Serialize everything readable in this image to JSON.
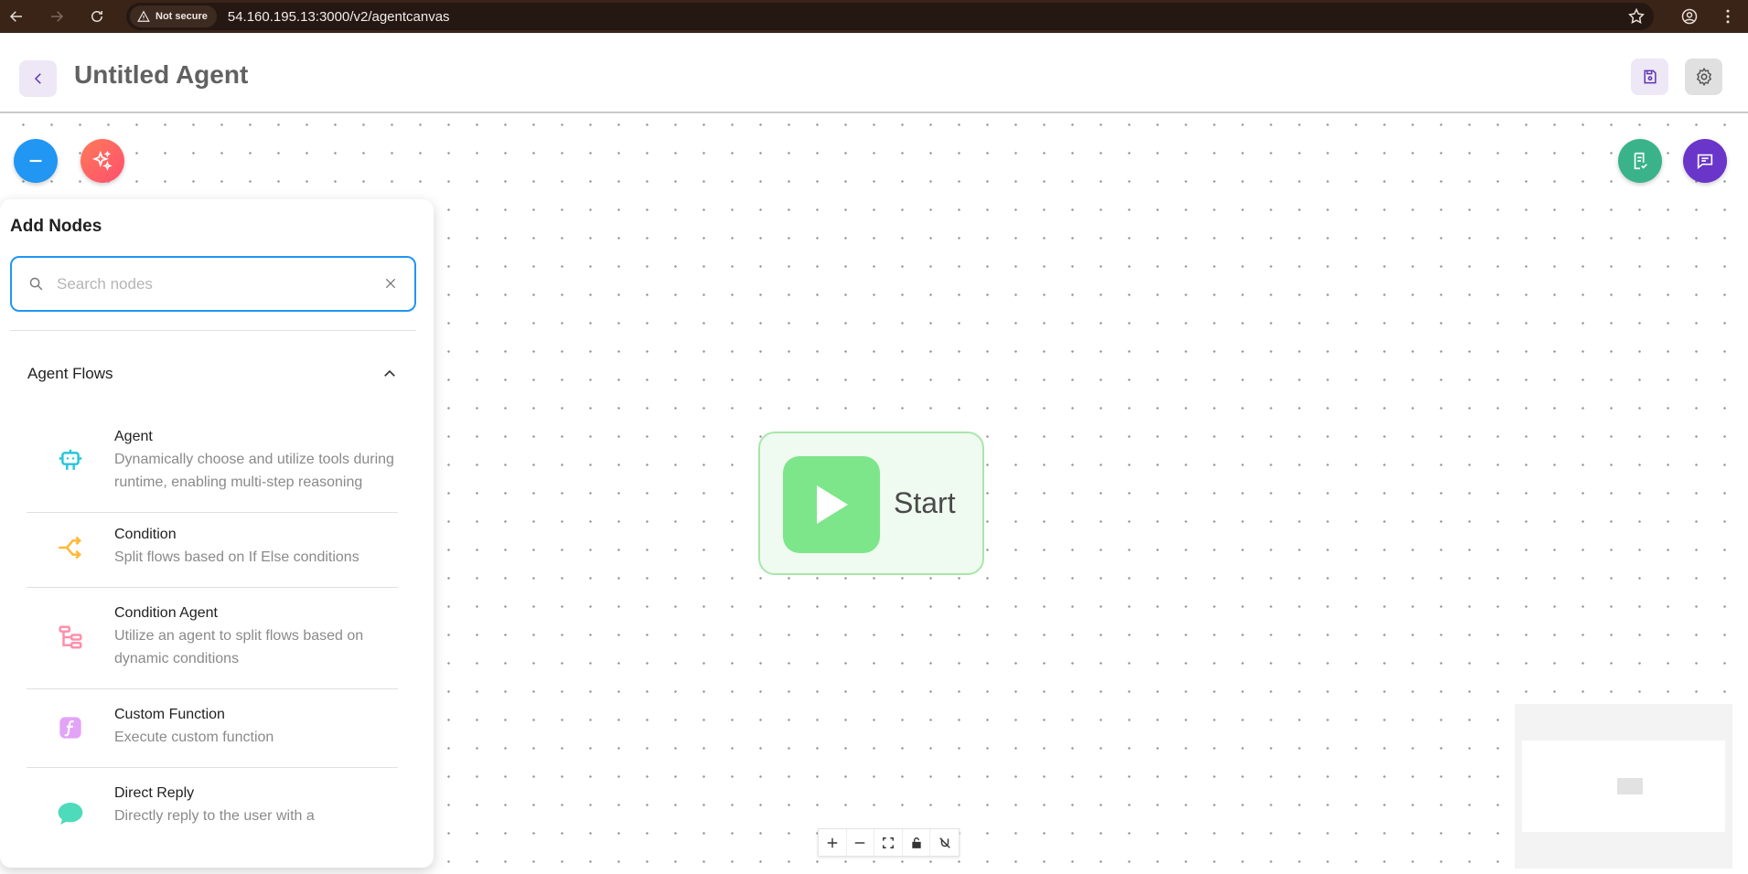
{
  "browser": {
    "security_label": "Not secure",
    "url": "54.160.195.13:3000/v2/agentcanvas"
  },
  "header": {
    "title": "Untitled Agent"
  },
  "start_node": {
    "label": "Start"
  },
  "panel": {
    "title": "Add Nodes",
    "search_placeholder": "Search nodes",
    "search_value": "",
    "section_title": "Agent Flows",
    "nodes": [
      {
        "name": "Agent",
        "description": "Dynamically choose and utilize tools during runtime, enabling multi-step reasoning",
        "icon": "robot-icon",
        "color": "#26c6da"
      },
      {
        "name": "Condition",
        "description": "Split flows based on If Else conditions",
        "icon": "split-icon",
        "color": "#ffb938"
      },
      {
        "name": "Condition Agent",
        "description": "Utilize an agent to split flows based on dynamic conditions",
        "icon": "subtask-icon",
        "color": "#ff8fab"
      },
      {
        "name": "Custom Function",
        "description": "Execute custom function",
        "icon": "function-icon",
        "color": "#e2a4f7"
      },
      {
        "name": "Direct Reply",
        "description": "Directly reply to the user with a",
        "icon": "message-icon",
        "color": "#4ddbbb"
      }
    ]
  },
  "colors": {
    "accent": "#2196f3",
    "start_green": "#7de58a",
    "chat_purple": "#6a35c9",
    "validate_green": "#3ab38a"
  }
}
